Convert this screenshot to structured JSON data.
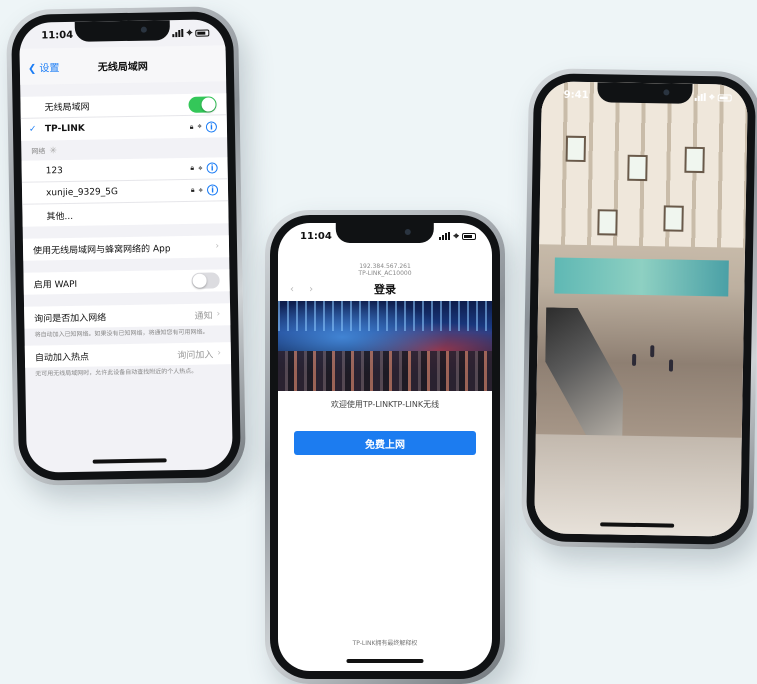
{
  "phone1": {
    "status_time": "11:04",
    "nav_back": "设置",
    "nav_title": "无线局域网",
    "wlan_label": "无线局域网",
    "wlan_on": true,
    "connected_network": "TP-LINK",
    "networks_section_label": "网络",
    "networks": [
      "123",
      "xunjie_9329_5G"
    ],
    "other_label": "其他...",
    "wlan_cellular_label": "使用无线局域网与蜂窝网络的 App",
    "wapi_label": "启用 WAPI",
    "ask_join_label": "询问是否加入网络",
    "ask_join_value": "通知",
    "ask_join_note": "将自动加入已知网络。如果没有已知网络，将通知您有可用网络。",
    "auto_hotspot_label": "自动加入热点",
    "auto_hotspot_value": "询问加入",
    "auto_hotspot_note": "无可用无线局域网时，允许此设备自动查找附近的个人热点。"
  },
  "phone2": {
    "status_time": "11:04",
    "ssid_line1": "192.384.567.261",
    "ssid_line2": "TP-LINK_AC10000",
    "arrows": "‹ ›",
    "title": "登录",
    "welcome": "欢迎使用TP-LINKTP-LINK无线",
    "button_label": "免费上网",
    "footer": "TP-LINK拥有最终解释权"
  },
  "phone3": {
    "status_time": "9:41"
  },
  "icons": {
    "back": "chevron-left-icon",
    "info": "info-icon",
    "lock": "lock-icon",
    "wifi": "wifi-icon",
    "check": "checkmark-icon"
  },
  "colors": {
    "accent_blue": "#1a7cf5",
    "toggle_green": "#34c759",
    "button_blue": "#1c7cf0"
  }
}
